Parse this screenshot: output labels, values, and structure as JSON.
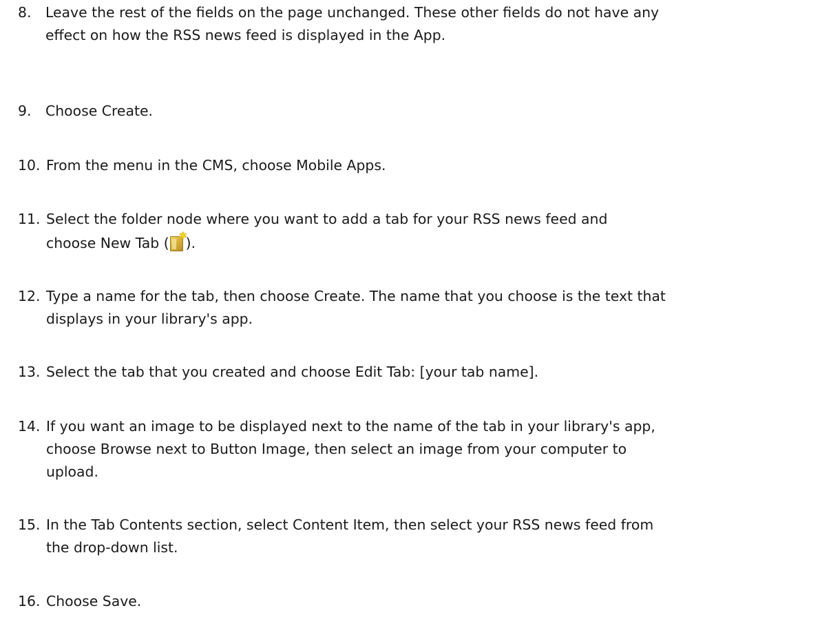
{
  "steps": [
    {
      "number": "8.",
      "lines": [
        "Leave the rest of the fields on the page unchanged. These other fields do not have any",
        "effect on how the RSS news feed is displayed in the App."
      ]
    },
    {
      "number": "9.",
      "lines": [
        "Choose Create."
      ]
    },
    {
      "number": "10.",
      "lines": [
        "From the menu in the CMS, choose Mobile Apps."
      ]
    },
    {
      "number": "11.",
      "lines": [
        "Select the folder node where you want to add a tab for your RSS news feed and"
      ],
      "icon_line_before": "choose New Tab (",
      "icon_line_after": ").",
      "icon": "new-tab-icon"
    },
    {
      "number": "12.",
      "lines": [
        "Type a name for the tab, then choose Create. The name that you choose is the text that",
        "displays in your library's app."
      ]
    },
    {
      "number": "13.",
      "lines": [
        "Select the tab that you created and choose Edit Tab: [your tab name]."
      ]
    },
    {
      "number": "14.",
      "lines": [
        "If you want an image to be displayed next to the name of the tab in your library's app,",
        "choose Browse next to Button Image, then select an image from your computer to",
        "upload."
      ]
    },
    {
      "number": "15.",
      "lines": [
        "In the Tab Contents section, select Content Item, then select your RSS news feed from",
        "the drop-down list."
      ]
    },
    {
      "number": "16.",
      "lines": [
        "Choose Save."
      ]
    }
  ]
}
